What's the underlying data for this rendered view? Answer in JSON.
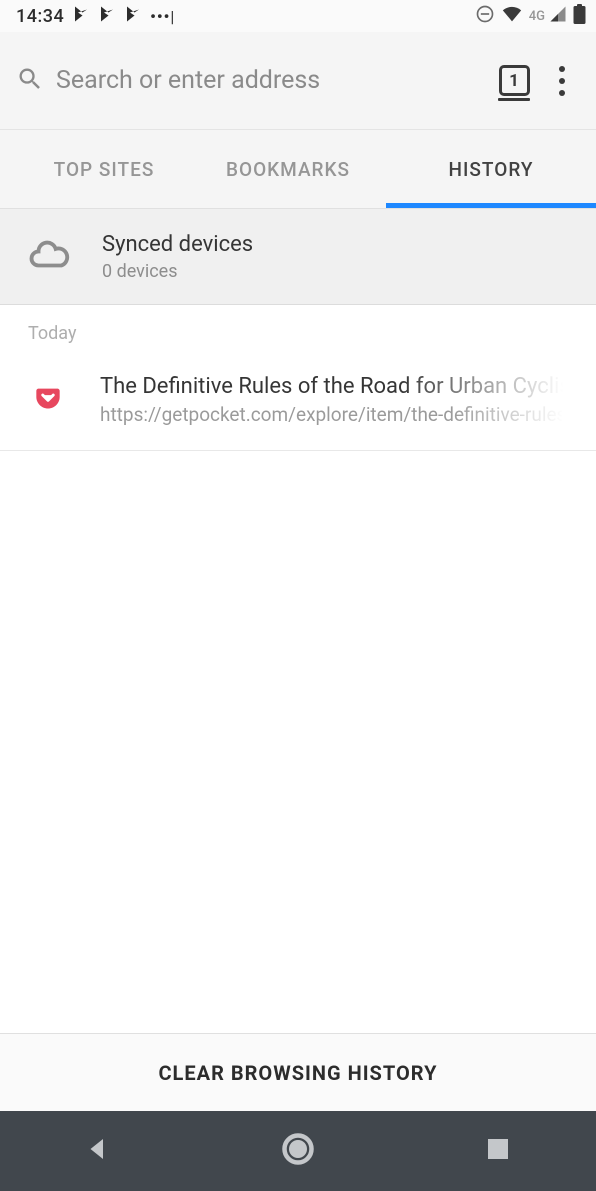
{
  "status_bar": {
    "time": "14:34",
    "network_type": "4G"
  },
  "toolbar": {
    "search_placeholder": "Search or enter address",
    "tab_count": "1"
  },
  "tabs": {
    "top_sites": "TOP SITES",
    "bookmarks": "BOOKMARKS",
    "history": "HISTORY"
  },
  "synced": {
    "title": "Synced devices",
    "subtitle": "0 devices"
  },
  "history": {
    "section_label": "Today",
    "items": [
      {
        "title": "The Definitive Rules of the Road for Urban Cyclists",
        "url": "https://getpocket.com/explore/item/the-definitive-rules"
      }
    ]
  },
  "footer": {
    "clear_label": "CLEAR BROWSING HISTORY"
  }
}
